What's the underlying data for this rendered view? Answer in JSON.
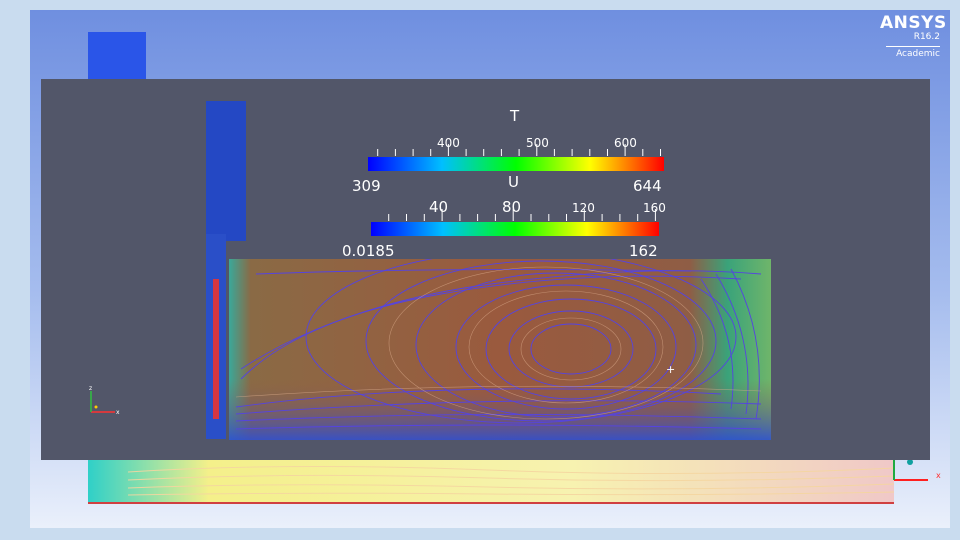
{
  "logo": {
    "brand": "ANSYS",
    "version": "R16.2",
    "edition": "Academic"
  },
  "legend_T": {
    "title": "T",
    "tick_labels": [
      "400",
      "500",
      "600"
    ],
    "min_label": "309",
    "max_label": "644",
    "min_value": 309,
    "max_value": 644
  },
  "legend_U": {
    "title": "U",
    "tick_labels": [
      "40",
      "80",
      "120",
      "160"
    ],
    "min_label": "0.0185",
    "max_label": "162",
    "min_value": 0.0185,
    "max_value": 162
  },
  "axis_triad": {
    "z_label": "z",
    "x_label": "x"
  },
  "colors": {
    "panel_bg": "#525669",
    "colormap": [
      "#0000ff",
      "#00bfff",
      "#00ff00",
      "#ffff00",
      "#ff0000"
    ],
    "inlet_blue": "#2244cc"
  }
}
